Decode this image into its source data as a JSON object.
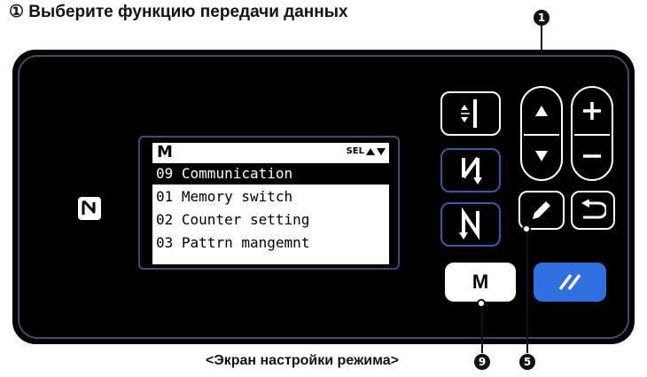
{
  "title": "① Выберите функцию передачи данных",
  "caption": "<Экран настройки режима>",
  "callouts": {
    "top": "1",
    "edit": "5",
    "mode": "9"
  },
  "screen": {
    "mode_label": "M",
    "sel_label": "SEL",
    "menu": [
      {
        "number": "09",
        "label": "Communication",
        "selected": true
      },
      {
        "number": "01",
        "label": "Memory switch",
        "selected": false
      },
      {
        "number": "02",
        "label": "Counter setting",
        "selected": false
      },
      {
        "number": "03",
        "label": "Pattrn mangemnt",
        "selected": false
      }
    ]
  },
  "buttons": {
    "m_label": "M",
    "n_label": "N"
  },
  "icons": [
    "nfc-icon",
    "stitch-icon",
    "reverse-n-icon",
    "n-icon",
    "up-arrow-icon",
    "down-arrow-icon",
    "plus-icon",
    "minus-icon",
    "pencil-icon",
    "return-icon",
    "reset-icon"
  ],
  "colors": {
    "panel": "#000000",
    "reset": "#2f6fe0",
    "frame": "#3a4f6b"
  }
}
